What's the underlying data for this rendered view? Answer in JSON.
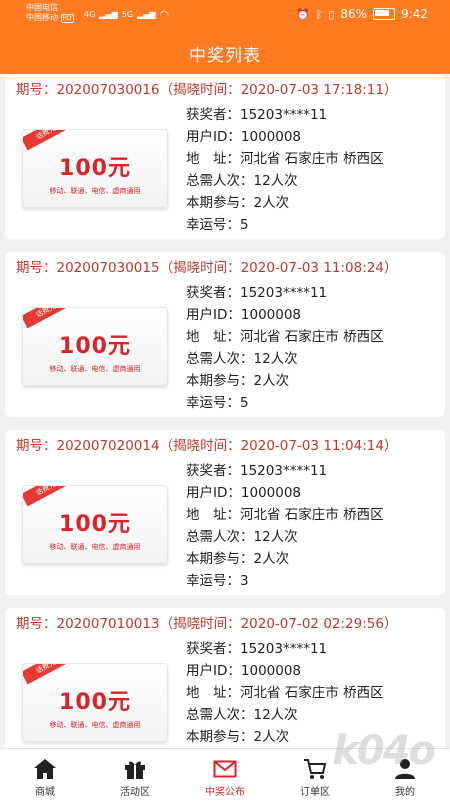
{
  "status": {
    "carrier_1": "中国电信",
    "carrier_2": "中国移动",
    "carrier_2_badge": "HD",
    "net_1": "4G",
    "net_2": "5G",
    "battery": "86%",
    "time": "9:42"
  },
  "header": {
    "title": "中奖列表"
  },
  "labels": {
    "winner": "获奖者：",
    "user_id": "用户ID：",
    "address": "地　址：",
    "total": "总需人次：",
    "joined": "本期参与：",
    "lucky": "幸运号："
  },
  "coupon": {
    "ribbon": "话费充值",
    "amount": "100元",
    "note": "移动、联通、电信、虚商通用"
  },
  "records": [
    {
      "head": "期号：202007030016（揭晓时间：2020-07-03 17:18:11）",
      "winner": "15203****11",
      "user_id": "1000008",
      "address": "河北省 石家庄市 桥西区",
      "total": "12人次",
      "joined": "2人次",
      "lucky": "5"
    },
    {
      "head": "期号：202007030015（揭晓时间：2020-07-03 11:08:24）",
      "winner": "15203****11",
      "user_id": "1000008",
      "address": "河北省 石家庄市 桥西区",
      "total": "12人次",
      "joined": "2人次",
      "lucky": "5"
    },
    {
      "head": "期号：202007020014（揭晓时间：2020-07-03 11:04:14）",
      "winner": "15203****11",
      "user_id": "1000008",
      "address": "河北省 石家庄市 桥西区",
      "total": "12人次",
      "joined": "2人次",
      "lucky": "3"
    },
    {
      "head": "期号：202007010013（揭晓时间：2020-07-02 02:29:56）",
      "winner": "15203****11",
      "user_id": "1000008",
      "address": "河北省 石家庄市 桥西区",
      "total": "12人次",
      "joined": "2人次",
      "lucky": ""
    }
  ],
  "nav": {
    "items": [
      {
        "label": "商城",
        "icon": "home-icon"
      },
      {
        "label": "活动区",
        "icon": "gift-icon"
      },
      {
        "label": "中奖公布",
        "icon": "envelope-icon"
      },
      {
        "label": "订单区",
        "icon": "cart-icon"
      },
      {
        "label": "我的",
        "icon": "user-icon"
      }
    ],
    "active_color": "#d8232a"
  },
  "colors": {
    "brand": "#ff7a21",
    "accent": "#c0392b"
  }
}
